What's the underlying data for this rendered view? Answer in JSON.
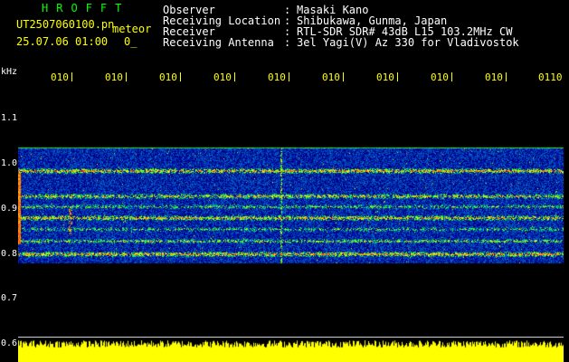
{
  "header": {
    "brand": "HROFFT",
    "filename": "UT2507060100.pn",
    "mode": "meteor",
    "datetime": "25.07.06 01:00",
    "counter": "0_",
    "info": [
      {
        "key": "Observer",
        "value": "Masaki Kano"
      },
      {
        "key": "Receiving Location",
        "value": "Shibukawa, Gunma, Japan"
      },
      {
        "key": "Receiver",
        "value": "RTL-SDR SDR# 43dB L15 103.2MHz CW"
      },
      {
        "key": "Receiving Antenna",
        "value": "3el Yagi(V) Az 330 for Vladivostok"
      }
    ],
    "separator": ":"
  },
  "axes": {
    "y_unit": "kHz",
    "y_ticks": [
      "1.1",
      "1.0",
      "0.9",
      "0.8",
      "0.7",
      "0.6"
    ],
    "x_ticks": [
      "010",
      "010",
      "010",
      "010",
      "010",
      "010",
      "010",
      "010",
      "010",
      "0110"
    ]
  },
  "colors": {
    "background": "#000000",
    "header_green": "#00ff00",
    "tick_yellow": "#ffff00",
    "power_yellow": "#ffff00"
  }
}
